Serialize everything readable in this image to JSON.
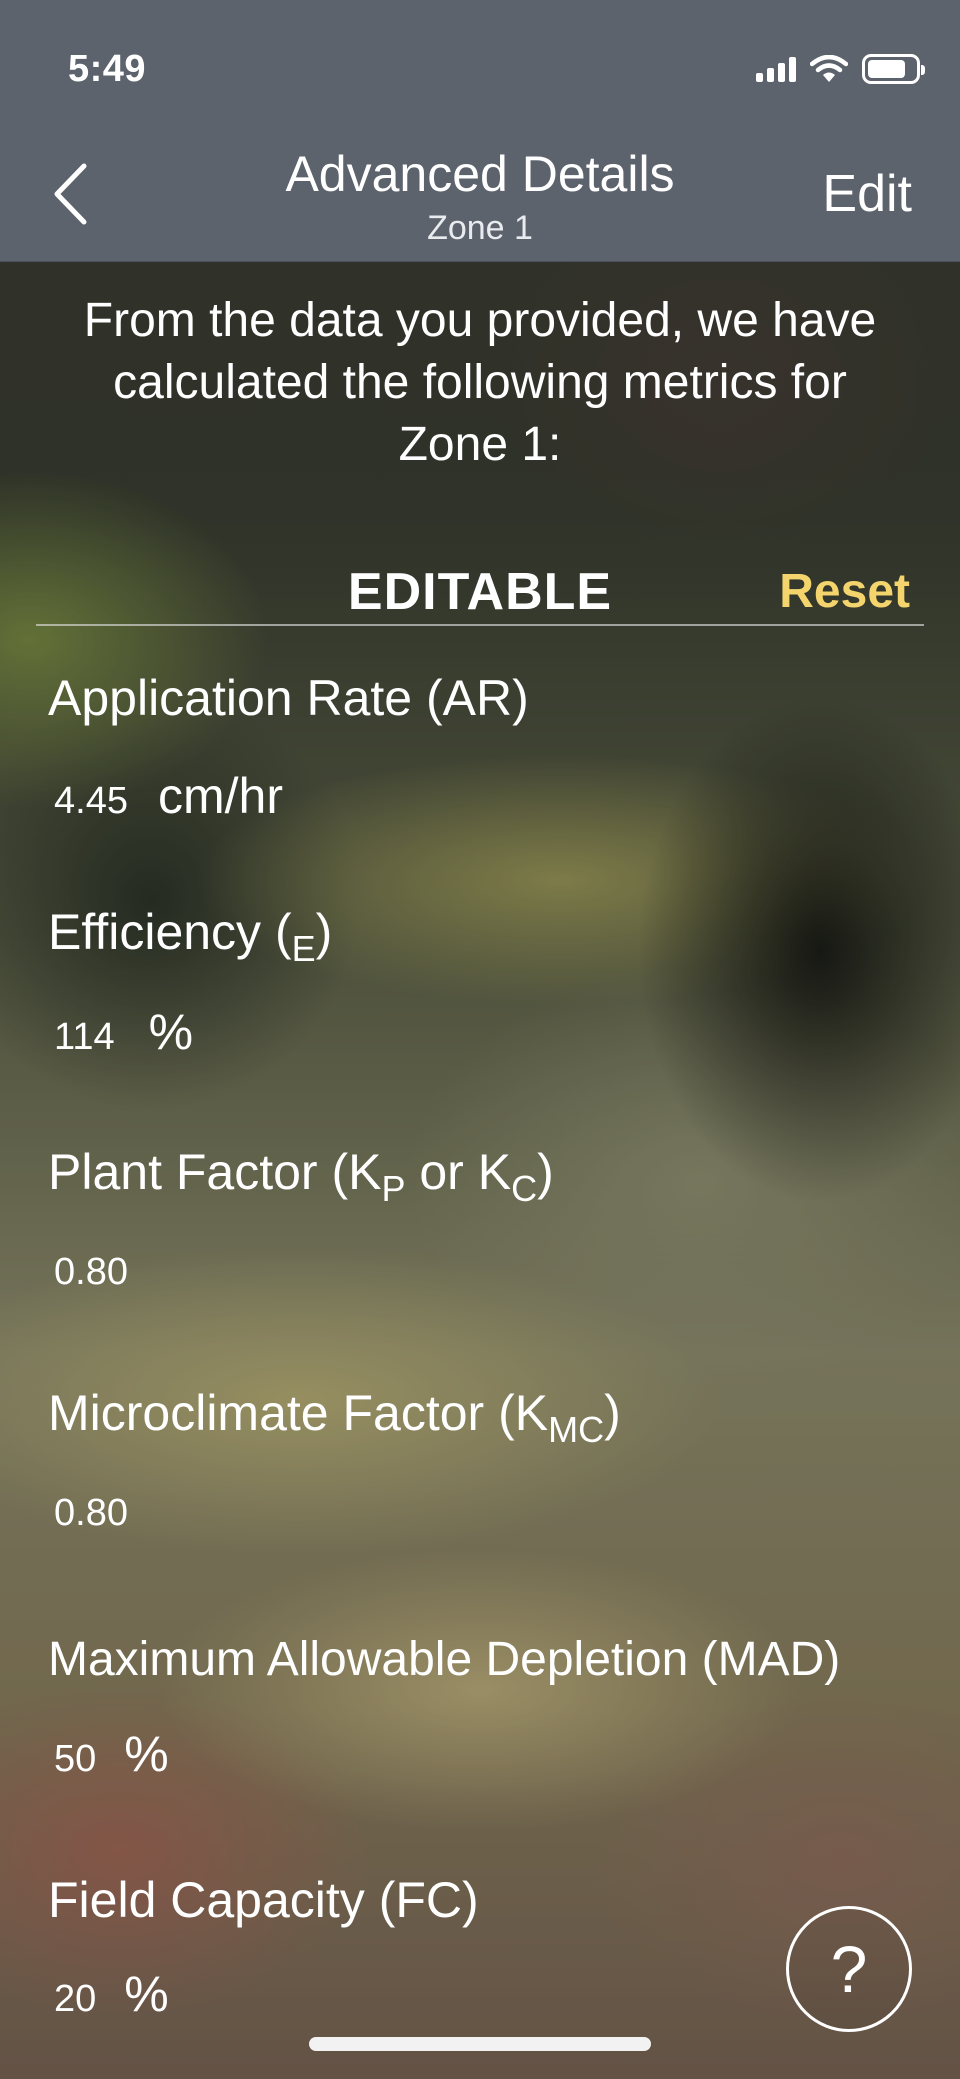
{
  "status_bar": {
    "time": "5:49"
  },
  "nav": {
    "title": "Advanced Details",
    "subtitle": "Zone 1",
    "edit_label": "Edit"
  },
  "intro_text": "From the data you provided, we have calculated the following metrics for Zone 1:",
  "section": {
    "title": "EDITABLE",
    "reset_label": "Reset"
  },
  "metrics": [
    {
      "label": "Application Rate (AR)",
      "value": "4.45",
      "unit": "cm/hr"
    },
    {
      "label_main": "Efficiency (",
      "label_sub": "E",
      "label_end": ")",
      "value": "114",
      "unit": "%"
    },
    {
      "label_main": "Plant Factor (K",
      "label_sub": "P",
      "label_mid": " or K",
      "label_sub2": "C",
      "label_end": ")",
      "value": "0.80",
      "unit": ""
    },
    {
      "label_main": "Microclimate Factor (K",
      "label_sub": "MC",
      "label_end": ")",
      "value": "0.80",
      "unit": ""
    },
    {
      "label": "Maximum Allowable Depletion (MAD)",
      "value": "50",
      "unit": "%"
    },
    {
      "label": "Field Capacity (FC)",
      "value": "20",
      "unit": "%"
    }
  ],
  "help_label": "?"
}
